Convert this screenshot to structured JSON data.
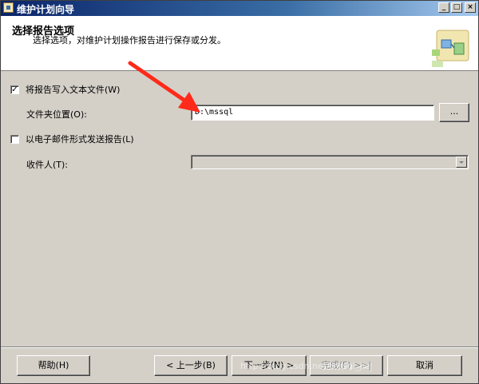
{
  "window": {
    "title": "维护计划向导"
  },
  "header": {
    "title": "选择报告选项",
    "subtitle": "选择选项，对维护计划操作报告进行保存或分发。"
  },
  "options": {
    "write_to_file": {
      "label": "将报告写入文本文件(W)",
      "checked": true
    },
    "folder_label": "文件夹位置(O):",
    "folder_value": "D:\\mssql",
    "browse_label": "...",
    "email_report": {
      "label": "以电子邮件形式发送报告(L)",
      "checked": false
    },
    "recipient_label": "收件人(T):",
    "recipient_value": ""
  },
  "footer": {
    "help": "帮助(H)",
    "back": "< 上一步(B)",
    "next": "下一步(N) >",
    "finish": "完成(F) >>|",
    "cancel": "取消"
  },
  "watermark": "http://blog.csdn.net/mssql_jie",
  "colors": {
    "dialog_bg": "#d4d0c8",
    "titlebar": "#0a246a",
    "arrow": "#ff2a1a"
  }
}
